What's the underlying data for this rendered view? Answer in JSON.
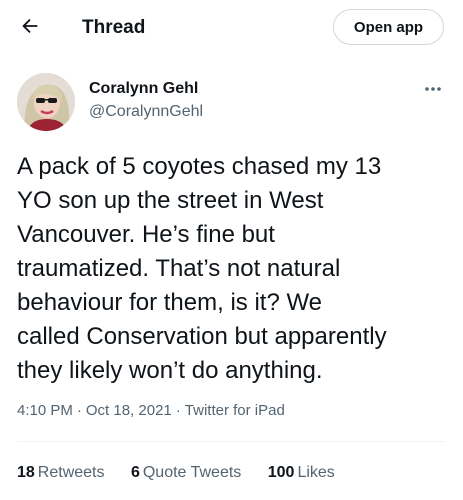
{
  "header": {
    "title": "Thread",
    "back_icon": "arrow-left-icon",
    "open_app_label": "Open app"
  },
  "author": {
    "name": "Coralynn Gehl",
    "handle": "@CoralynnGehl",
    "more_icon": "ellipsis-icon"
  },
  "tweet": {
    "lines": [
      "A pack of 5 coyotes chased my 13",
      "YO son up the street in West",
      "Vancouver. He’s fine but",
      "traumatized. That’s not natural",
      "behaviour for them, is it? We",
      "called Conservation but apparently",
      "they likely won’t do anything."
    ],
    "time": "4:10 PM",
    "date": "Oct 18, 2021",
    "separator": "·",
    "source": "Twitter for iPad"
  },
  "stats": [
    {
      "count": "18",
      "label": "Retweets"
    },
    {
      "count": "6",
      "label": "Quote Tweets"
    },
    {
      "count": "100",
      "label": "Likes"
    }
  ],
  "colors": {
    "text": "#0f1419",
    "secondary": "#536471",
    "border": "#cfd9de",
    "divider": "#eff3f4"
  }
}
